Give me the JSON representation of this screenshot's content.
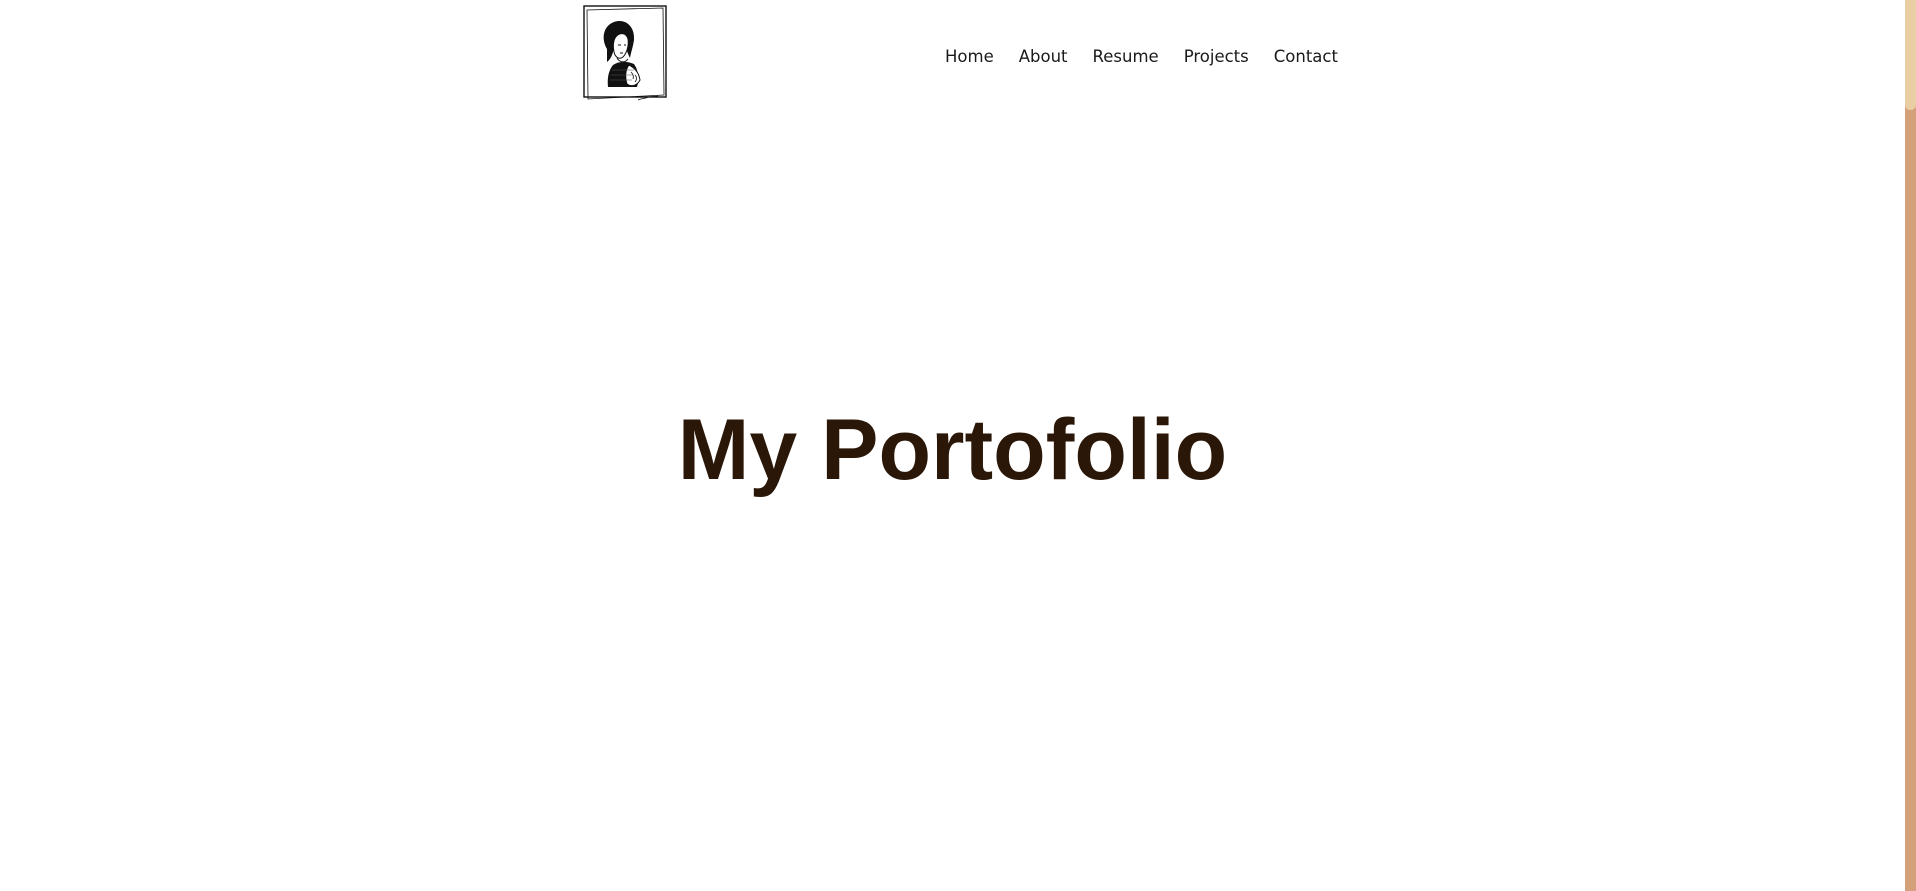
{
  "header": {
    "logo_alt": "portrait sketch logo",
    "nav": [
      {
        "label": "Home"
      },
      {
        "label": "About"
      },
      {
        "label": "Resume"
      },
      {
        "label": "Projects"
      },
      {
        "label": "Contact"
      }
    ]
  },
  "hero": {
    "title": "My Portofolio"
  },
  "colors": {
    "title": "#2b1708",
    "scrollbar_track": "#d4a07a",
    "scrollbar_thumb": "#e9cda3"
  }
}
